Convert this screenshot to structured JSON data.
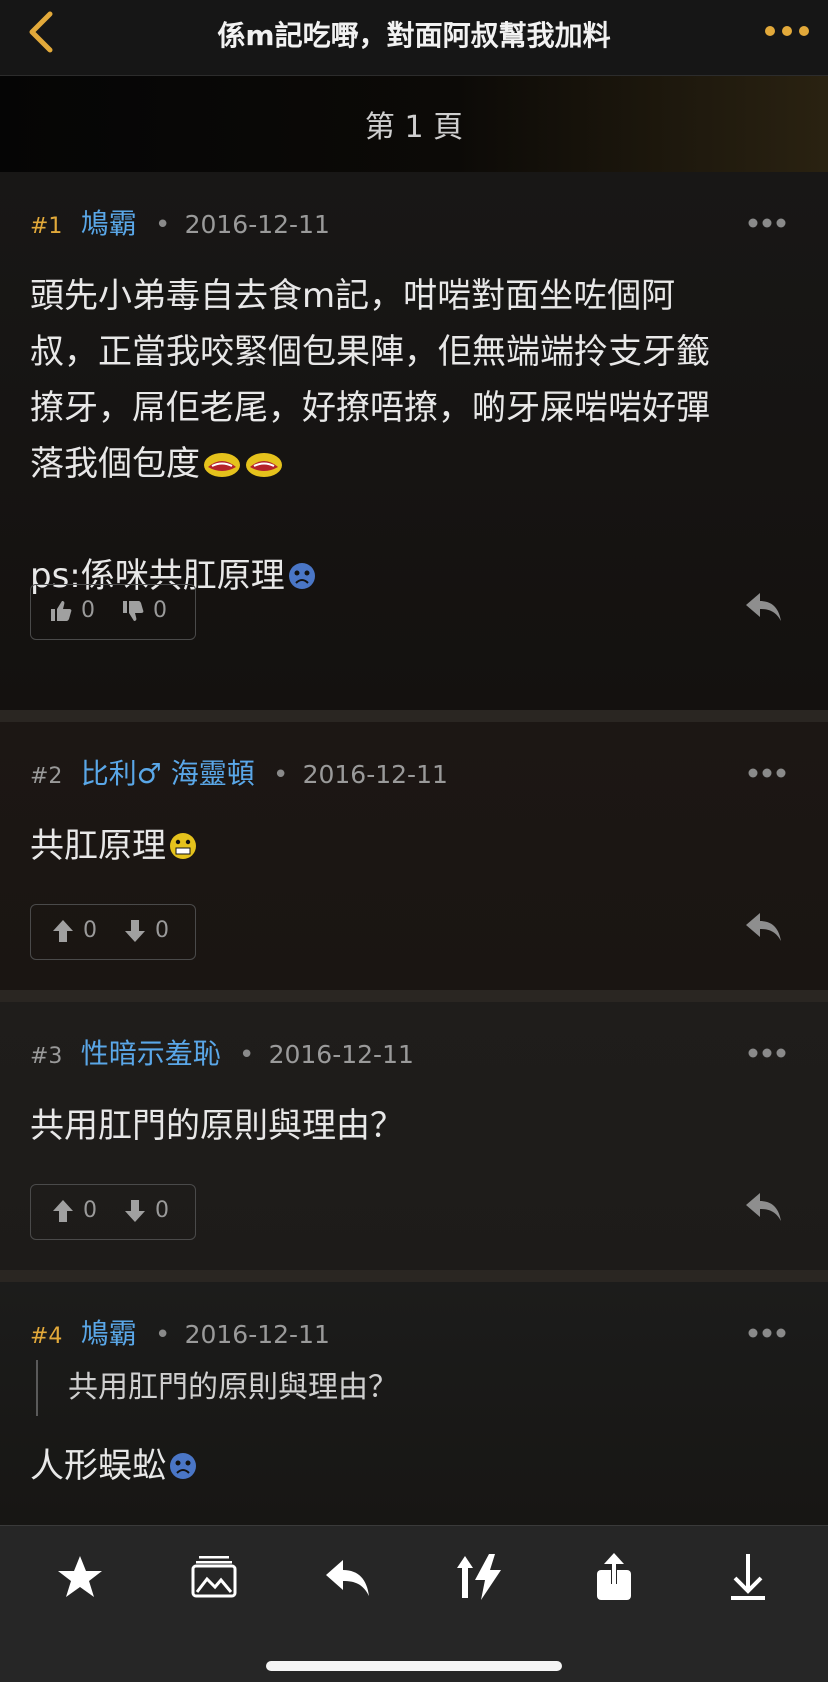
{
  "header": {
    "title": "係m記吃嘢，對面阿叔幫我加料"
  },
  "page_label": "第 1 頁",
  "posts": [
    {
      "number": "#1",
      "user": "鳩霸",
      "date": "2016-12-11",
      "lines": [
        "頭先小弟毒自去食m記，咁啱對面坐咗個阿",
        "叔，正當我咬緊個包果陣，佢無端端拎支牙籤",
        "撩牙，屌佢老尾，好撩唔撩，啲牙屎啱啱好彈",
        "落我個包度"
      ],
      "ps": "ps:係咪共肛原理",
      "likes": "0",
      "dislikes": "0"
    },
    {
      "number": "#2",
      "user": "比利♂ 海靈頓",
      "date": "2016-12-11",
      "text": "共肛原理",
      "likes": "0",
      "dislikes": "0"
    },
    {
      "number": "#3",
      "user": "性暗示羞恥",
      "date": "2016-12-11",
      "text": "共用肛門的原則與理由？",
      "likes": "0",
      "dislikes": "0"
    },
    {
      "number": "#4",
      "user": "鳩霸",
      "date": "2016-12-11",
      "quote": "共用肛門的原則與理由？",
      "text": "人形蜈蚣"
    }
  ],
  "colors": {
    "accent": "#e2a93a",
    "username": "#5aa7e8",
    "background": "#120f0d",
    "toolbar": "#262626"
  },
  "toolbar_icons": [
    "star-icon",
    "image-icon",
    "reply-icon",
    "sort-lightning-icon",
    "share-icon",
    "download-icon"
  ]
}
